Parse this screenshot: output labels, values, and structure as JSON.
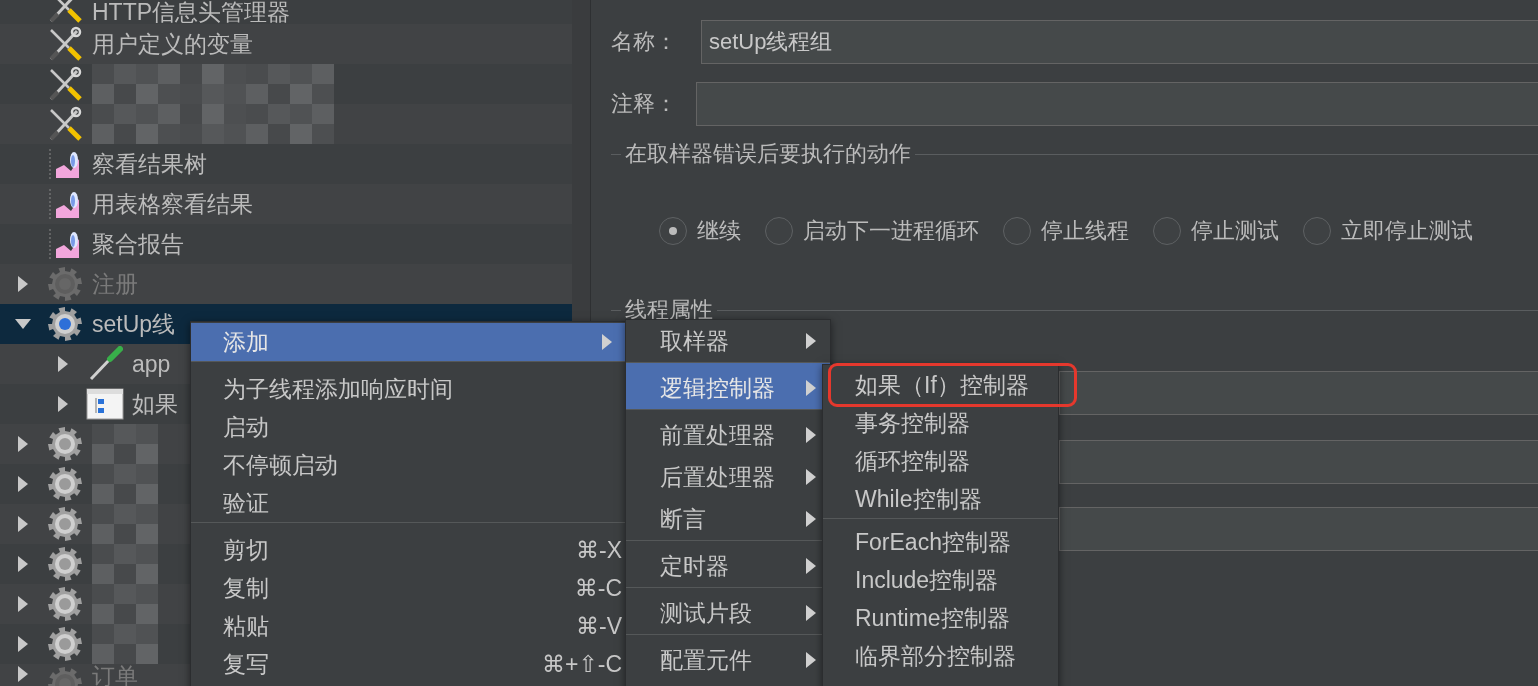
{
  "tree": {
    "items": [
      {
        "kind": "tools",
        "label": "HTTP信息头管理器",
        "selected": false,
        "disabled": false
      },
      {
        "kind": "tools",
        "label": "用户定义的变量",
        "selected": false,
        "disabled": false
      },
      {
        "kind": "tools",
        "blurred": true,
        "selected": false,
        "disabled": false
      },
      {
        "kind": "tools",
        "blurred": true,
        "selected": false,
        "disabled": false
      },
      {
        "kind": "chart",
        "label": "察看结果树",
        "selected": false,
        "disabled": false
      },
      {
        "kind": "chart",
        "label": "用表格察看结果",
        "selected": false,
        "disabled": false
      },
      {
        "kind": "chart",
        "label": "聚合报告",
        "selected": false,
        "disabled": false
      },
      {
        "kind": "thread-group",
        "label": "注册",
        "expanded": false,
        "selected": false,
        "disabled": true
      },
      {
        "kind": "thread-group",
        "label": "setUp线",
        "expanded": true,
        "selected": true,
        "disabled": false,
        "children": [
          {
            "kind": "sampler",
            "label": "app",
            "expanded": false,
            "selected": false,
            "disabled": false
          },
          {
            "kind": "if-controller",
            "label": "如果",
            "expanded": false,
            "selected": false,
            "disabled": false
          }
        ]
      },
      {
        "kind": "thread-group",
        "blurred": true,
        "expanded": false,
        "selected": false,
        "disabled": false
      },
      {
        "kind": "thread-group",
        "blurred": true,
        "expanded": false,
        "selected": false,
        "disabled": false
      },
      {
        "kind": "thread-group",
        "blurred": true,
        "expanded": false,
        "selected": false,
        "disabled": false
      },
      {
        "kind": "thread-group",
        "blurred": true,
        "expanded": false,
        "selected": false,
        "disabled": false
      },
      {
        "kind": "thread-group",
        "blurred": true,
        "expanded": false,
        "selected": false,
        "disabled": false
      },
      {
        "kind": "thread-group",
        "blurred": true,
        "expanded": false,
        "selected": false,
        "disabled": false
      },
      {
        "kind": "thread-group",
        "label": "订单",
        "expanded": false,
        "selected": false,
        "disabled": true
      }
    ]
  },
  "form": {
    "name": {
      "label": "名称：",
      "value": "setUp线程组"
    },
    "comment": {
      "label": "注释："
    },
    "error_action": {
      "title": "在取样器错误后要执行的动作",
      "options": [
        {
          "label": "继续",
          "selected": true
        },
        {
          "label": "启动下一进程循环",
          "selected": false
        },
        {
          "label": "停止线程",
          "selected": false
        },
        {
          "label": "停止测试",
          "selected": false
        },
        {
          "label": "立即停止测试",
          "selected": false
        }
      ]
    },
    "thread_properties": {
      "title": "线程属性",
      "fields": [
        {
          "kind": "text"
        },
        {
          "kind": "text"
        },
        {
          "kind": "text"
        }
      ]
    }
  },
  "context_menu": {
    "items": [
      {
        "label": "添加",
        "submenu": true,
        "selected": true
      },
      {
        "label": "为子线程添加响应时间",
        "separator_before": true,
        "selected": false
      },
      {
        "label": "启动",
        "selected": false
      },
      {
        "label": "不停顿启动",
        "selected": false
      },
      {
        "label": "验证",
        "selected": false
      },
      {
        "label": "剪切",
        "shortcut": "⌘-X",
        "separator_before": true,
        "selected": false
      },
      {
        "label": "复制",
        "shortcut": "⌘-C",
        "selected": false
      },
      {
        "label": "粘贴",
        "shortcut": "⌘-V",
        "selected": false
      },
      {
        "label": "复写",
        "shortcut": "⌘+⇧-C",
        "selected": false
      }
    ]
  },
  "add_submenu": {
    "items": [
      {
        "label": "取样器",
        "submenu": true,
        "selected": false
      },
      {
        "label": "逻辑控制器",
        "submenu": true,
        "separator_before": true,
        "selected": true
      },
      {
        "label": "前置处理器",
        "submenu": true,
        "separator_before": true,
        "selected": false
      },
      {
        "label": "后置处理器",
        "submenu": true,
        "selected": false
      },
      {
        "label": "断言",
        "submenu": true,
        "selected": false
      },
      {
        "label": "定时器",
        "submenu": true,
        "separator_before": true,
        "selected": false
      },
      {
        "label": "测试片段",
        "submenu": true,
        "separator_before": true,
        "selected": false
      },
      {
        "label": "配置元件",
        "submenu": true,
        "separator_before": true,
        "selected": false
      }
    ]
  },
  "controller_submenu": {
    "items": [
      {
        "label": "如果（If）控制器",
        "selected": false,
        "highlighted": true
      },
      {
        "label": "事务控制器",
        "selected": false,
        "highlighted": false
      },
      {
        "label": "循环控制器",
        "selected": false,
        "highlighted": false
      },
      {
        "label": "While控制器",
        "selected": false,
        "highlighted": false
      },
      {
        "label": "ForEach控制器",
        "separator_before": true,
        "selected": false,
        "highlighted": false
      },
      {
        "label": "Include控制器",
        "selected": false,
        "highlighted": false
      },
      {
        "label": "Runtime控制器",
        "selected": false,
        "highlighted": false
      },
      {
        "label": "临界部分控制器",
        "selected": false,
        "highlighted": false
      }
    ]
  }
}
